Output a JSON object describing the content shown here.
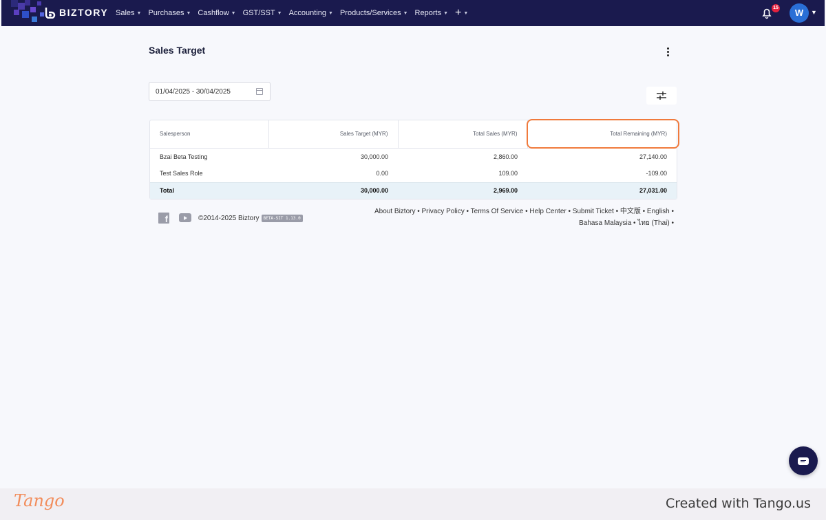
{
  "app": {
    "brand": "BIZTORY",
    "accent_color": "#1a1a4e",
    "highlight_color": "#f07a3c"
  },
  "nav": {
    "items": [
      {
        "label": "Sales"
      },
      {
        "label": "Purchases"
      },
      {
        "label": "Cashflow"
      },
      {
        "label": "GST/SST"
      },
      {
        "label": "Accounting"
      },
      {
        "label": "Products/Services"
      },
      {
        "label": "Reports"
      }
    ],
    "plus": "+",
    "notification_count": "15",
    "avatar_initial": "W"
  },
  "page": {
    "title": "Sales Target",
    "date_range": "01/04/2025 - 30/04/2025"
  },
  "table": {
    "headers": [
      "Salesperson",
      "Sales Target (MYR)",
      "Total Sales (MYR)",
      "Total Remaining (MYR)"
    ],
    "rows": [
      [
        "Bzai Beta Testing",
        "30,000.00",
        "2,860.00",
        "27,140.00"
      ],
      [
        "Test Sales Role",
        "0.00",
        "109.00",
        "-109.00"
      ]
    ],
    "total": [
      "Total",
      "30,000.00",
      "2,969.00",
      "27,031.00"
    ]
  },
  "footer": {
    "copyright": "©2014-2025 Biztory",
    "version": "BETA-SIT 1.13.0",
    "links_line1": "About Biztory • Privacy Policy • Terms Of Service • Help Center • Submit Ticket • 中文版 • English •",
    "links_line2": "Bahasa Malaysia • ไทย (Thai) •"
  },
  "tango": {
    "logo": "Tango",
    "created": "Created with Tango.us"
  }
}
